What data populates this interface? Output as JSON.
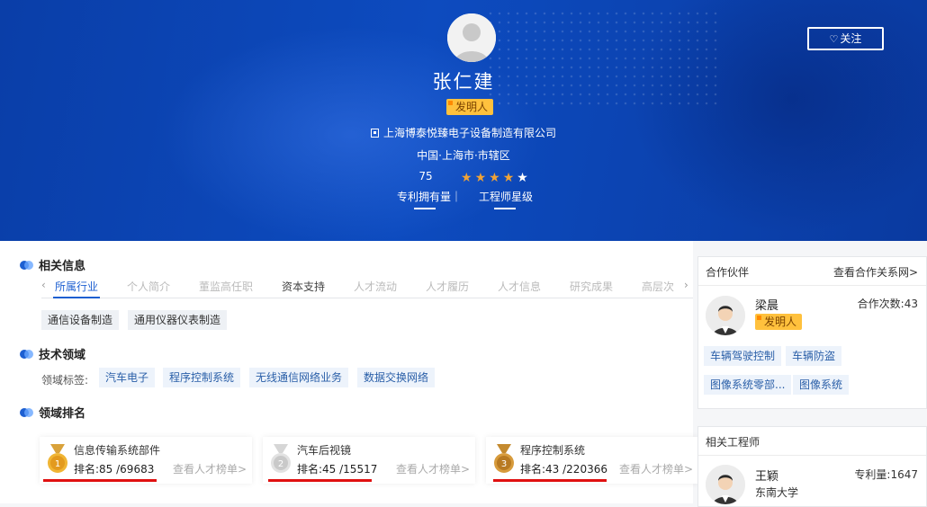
{
  "profile": {
    "name": "张仁建",
    "badge": "发明人",
    "company": "上海博泰悦臻电子设备制造有限公司",
    "location": "中国·上海市·市辖区",
    "patent_count": "75",
    "patent_label": "专利拥有量｜",
    "level_label": "工程师星级",
    "stars_filled": 4,
    "stars_total": 5,
    "follow_label": "关注"
  },
  "related": {
    "title": "相关信息",
    "tabs": [
      "所属行业",
      "个人简介",
      "董监高任职",
      "资本支持",
      "人才流动",
      "人才履历",
      "人才信息",
      "研究成果",
      "高层次"
    ],
    "active_tab": "所属行业",
    "industries": [
      "通信设备制造",
      "通用仪器仪表制造"
    ]
  },
  "tech": {
    "title": "技术领域",
    "label": "领域标签:",
    "tags": [
      "汽车电子",
      "程序控制系统",
      "无线通信网络业务",
      "数据交换网络"
    ]
  },
  "ranking": {
    "title": "领域排名",
    "cards": [
      {
        "field": "信息传输系统部件",
        "rank": "排名:85 /69683",
        "link": "查看人才榜单>",
        "medal": "1",
        "medal_color": "#e6a22a"
      },
      {
        "field": "汽车后视镜",
        "rank": "排名:45 /15517",
        "link": "查看人才榜单>",
        "medal": "2",
        "medal_color": "#c8c8c8"
      },
      {
        "field": "程序控制系统",
        "rank": "排名:43 /220366",
        "link": "查看人才榜单>",
        "medal": "3",
        "medal_color": "#d89a3a"
      }
    ]
  },
  "partners": {
    "title": "合作伙伴",
    "link": "查看合作关系网>",
    "person": {
      "name": "梁晨",
      "badge": "发明人",
      "coop": "合作次数:43",
      "tags": [
        "车辆驾驶控制",
        "车辆防盗",
        "图像系统零部...",
        "图像系统"
      ]
    }
  },
  "engineers": {
    "title": "相关工程师",
    "person": {
      "name": "王颖",
      "school": "东南大学",
      "patents": "专利量:1647"
    }
  },
  "colors": {
    "accent": "#1d5fd1",
    "hero_bg": "#0d4bbf",
    "star": "#f0a336",
    "badge": "#ffc13d",
    "highlight": "#e01010"
  }
}
